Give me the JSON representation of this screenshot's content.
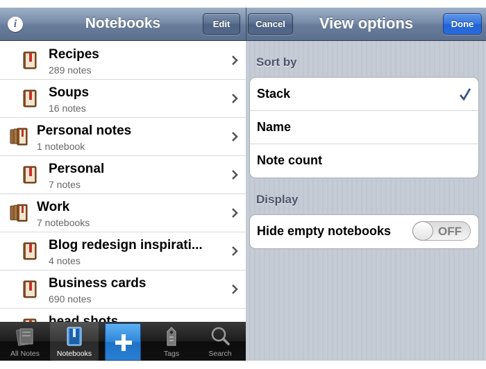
{
  "notebooks_panel": {
    "title": "Notebooks",
    "edit_label": "Edit",
    "info_icon": "info-icon",
    "rows": [
      {
        "name": "Recipes",
        "count": "289 notes",
        "kind": "notebook"
      },
      {
        "name": "Soups",
        "count": "16 notes",
        "kind": "notebook"
      },
      {
        "name": "Personal notes",
        "count": "1 notebook",
        "kind": "stack"
      },
      {
        "name": "Personal",
        "count": "7 notes",
        "kind": "notebook"
      },
      {
        "name": "Work",
        "count": "7 notebooks",
        "kind": "stack"
      },
      {
        "name": "Blog redesign inspirati...",
        "count": "4 notes",
        "kind": "notebook"
      },
      {
        "name": "Business cards",
        "count": "690 notes",
        "kind": "notebook"
      },
      {
        "name": "head shots",
        "count": "",
        "kind": "notebook"
      }
    ],
    "tabs": [
      {
        "label": "All Notes",
        "icon": "all-notes-icon",
        "active": false
      },
      {
        "label": "Notebooks",
        "icon": "notebook-icon",
        "active": true
      },
      {
        "label": "",
        "icon": "plus-icon",
        "active": false
      },
      {
        "label": "Tags",
        "icon": "tag-icon",
        "active": false
      },
      {
        "label": "Search",
        "icon": "search-icon",
        "active": false
      }
    ]
  },
  "view_options": {
    "title": "View options",
    "cancel_label": "Cancel",
    "done_label": "Done",
    "sort_by": {
      "label": "Sort by",
      "options": [
        "Stack",
        "Name",
        "Note count"
      ],
      "selected": "Stack"
    },
    "display": {
      "label": "Display",
      "hide_empty_label": "Hide empty notebooks",
      "toggle_state": "OFF"
    }
  },
  "colors": {
    "navbar": "#6a7e9c",
    "done_button": "#2a6cdb",
    "checkmark": "#385487",
    "add_tab": "#2e86d8"
  }
}
